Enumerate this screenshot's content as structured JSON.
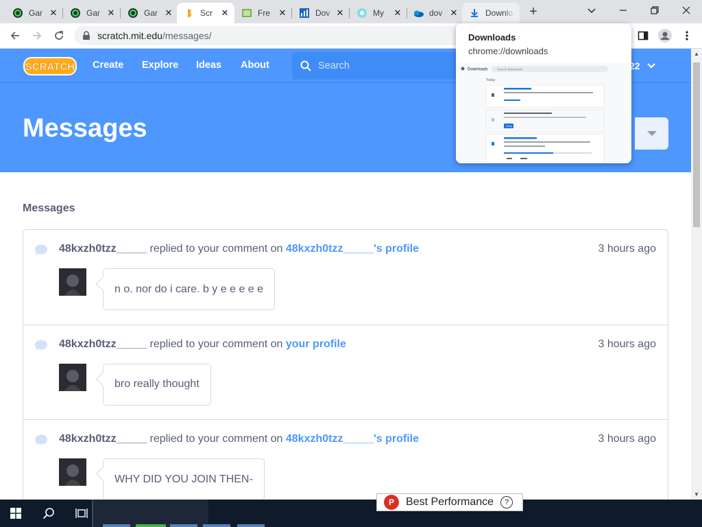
{
  "browser": {
    "tabs": [
      {
        "label": "Gar",
        "icon": "garage-icon",
        "state": "normal"
      },
      {
        "label": "Gar",
        "icon": "garage-icon",
        "state": "normal"
      },
      {
        "label": "Gar",
        "icon": "garage-icon",
        "state": "normal"
      },
      {
        "label": "Scr",
        "icon": "scratch-icon",
        "state": "active"
      },
      {
        "label": "Fre",
        "icon": "image-icon",
        "state": "normal"
      },
      {
        "label": "Dov",
        "icon": "chart-icon",
        "state": "normal"
      },
      {
        "label": "My",
        "icon": "globe-icon",
        "state": "normal"
      },
      {
        "label": "dov",
        "icon": "onedrive-icon",
        "state": "normal"
      },
      {
        "label": "Downlo",
        "icon": "download-icon",
        "state": "hover"
      }
    ],
    "url_host": "scratch.mit.edu",
    "url_path": "/messages/",
    "hovercard": {
      "title": "Downloads",
      "url": "chrome://downloads",
      "preview_header": "Downloads",
      "preview_search": "Search downloads",
      "preview_today": "Today",
      "preview_btn": "Keep"
    }
  },
  "scratch": {
    "nav": {
      "create": "Create",
      "explore": "Explore",
      "ideas": "Ideas",
      "about": "About",
      "search_placeholder": "Search",
      "account_suffix": "22"
    },
    "hero_title": "Messages",
    "section_title": "Messages",
    "messages": [
      {
        "user": "48kxzh0tzz_____",
        "action": "replied to your comment on",
        "target": "48kxzh0tzz_____'s profile",
        "time": "3 hours ago",
        "comment": "n o. nor do i care. b y e e e e e"
      },
      {
        "user": "48kxzh0tzz_____",
        "action": "replied to your comment on",
        "target": "your profile",
        "time": "3 hours ago",
        "comment": "bro really thought"
      },
      {
        "user": "48kxzh0tzz_____",
        "action": "replied to your comment on",
        "target": "48kxzh0tzz_____'s profile",
        "time": "3 hours ago",
        "comment": "WHY DID YOU JOIN THEN-"
      }
    ]
  },
  "taskbar": {
    "popup_label": "Best Performance",
    "popup_help": "?",
    "popup_badge": "P"
  },
  "colors": {
    "scratch_blue": "#4d97ff",
    "scratch_text": "#575e75",
    "taskbar": "#0f1a2b"
  }
}
